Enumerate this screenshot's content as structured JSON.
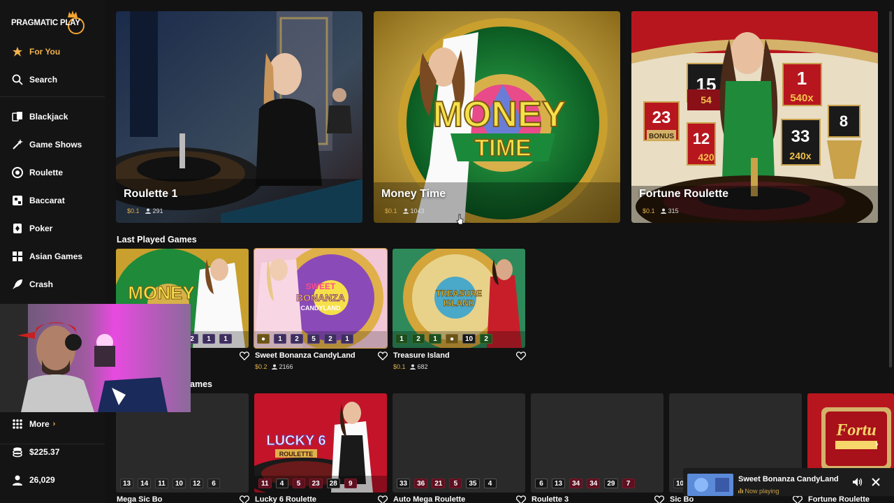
{
  "brand": {
    "logo_text": "PRAGMATIC PLAY"
  },
  "sidebar": {
    "items": [
      {
        "label": "For You",
        "icon": "star-badge-icon"
      },
      {
        "label": "Search",
        "icon": "search-icon"
      },
      {
        "label": "Blackjack",
        "icon": "cards-icon"
      },
      {
        "label": "Game Shows",
        "icon": "sparkle-icon"
      },
      {
        "label": "Roulette",
        "icon": "roulette-icon"
      },
      {
        "label": "Baccarat",
        "icon": "baccarat-icon"
      },
      {
        "label": "Poker",
        "icon": "poker-icon"
      },
      {
        "label": "Asian Games",
        "icon": "asian-games-icon"
      },
      {
        "label": "Crash",
        "icon": "rocket-icon"
      }
    ],
    "more_label": "More",
    "balance": "$225.37",
    "points": "26,029"
  },
  "featured": [
    {
      "title": "Roulette 1",
      "bet": "$0.1",
      "players": "291"
    },
    {
      "title": "Money Time",
      "bet": "$0.1",
      "players": "1043"
    },
    {
      "title": "Fortune Roulette",
      "bet": "$0.1",
      "players": "315"
    }
  ],
  "last_played": {
    "title": "Last Played Games",
    "tiles": [
      {
        "name": "",
        "bet": "",
        "players": "",
        "numbers": [
          "2",
          "1",
          "1"
        ]
      },
      {
        "name": "Sweet Bonanza CandyLand",
        "bet": "$0.2",
        "players": "2166",
        "numbers": [
          "1",
          "2",
          "5",
          "2",
          "1"
        ]
      },
      {
        "name": "Treasure Island",
        "bet": "$0.1",
        "players": "682",
        "numbers": [
          "1",
          "2",
          "1",
          "10",
          "2"
        ]
      }
    ]
  },
  "next_section": {
    "title_fragment": "ames",
    "tiles": [
      {
        "name": "Mega Sic Bo",
        "numbers": [
          "13",
          "14",
          "11",
          "10",
          "12",
          "6"
        ]
      },
      {
        "name": "Lucky 6 Roulette",
        "numbers": [
          "11",
          "4",
          "5",
          "23",
          "28",
          "9"
        ]
      },
      {
        "name": "Auto Mega Roulette",
        "numbers": [
          "33",
          "36",
          "21",
          "5",
          "35",
          "4"
        ]
      },
      {
        "name": "Roulette 3",
        "numbers": [
          "6",
          "13",
          "34",
          "34",
          "29",
          "7"
        ]
      },
      {
        "name": "Sic Bo",
        "numbers": [
          "10"
        ]
      },
      {
        "name": "Fortune Roulette",
        "numbers": []
      }
    ]
  },
  "art_text": {
    "money_line1": "MONEY",
    "money_line2": "TIME",
    "sweet": "SWEET",
    "bonanza": "BONANZA",
    "candyland": "CANDYLAND",
    "treasure": "TREASURE",
    "island": "ISLAND",
    "lucky6": "LUCKY 6",
    "roulette_word": "ROULETTE",
    "fortune": "Fortu",
    "bonus": "BONUS",
    "fr_15": "15",
    "fr_54": "54",
    "fr_1": "1",
    "fr_540x": "540x",
    "fr_23": "23",
    "fr_12": "12",
    "fr_420": "420",
    "fr_33": "33",
    "fr_240x": "240x",
    "fr_8": "8"
  },
  "now_playing": {
    "title": "Sweet Bonanza CandyLand",
    "status": "Now playing"
  },
  "colors": {
    "accent": "#f3b14b",
    "background": "#121212",
    "sidebar": "#141414"
  }
}
